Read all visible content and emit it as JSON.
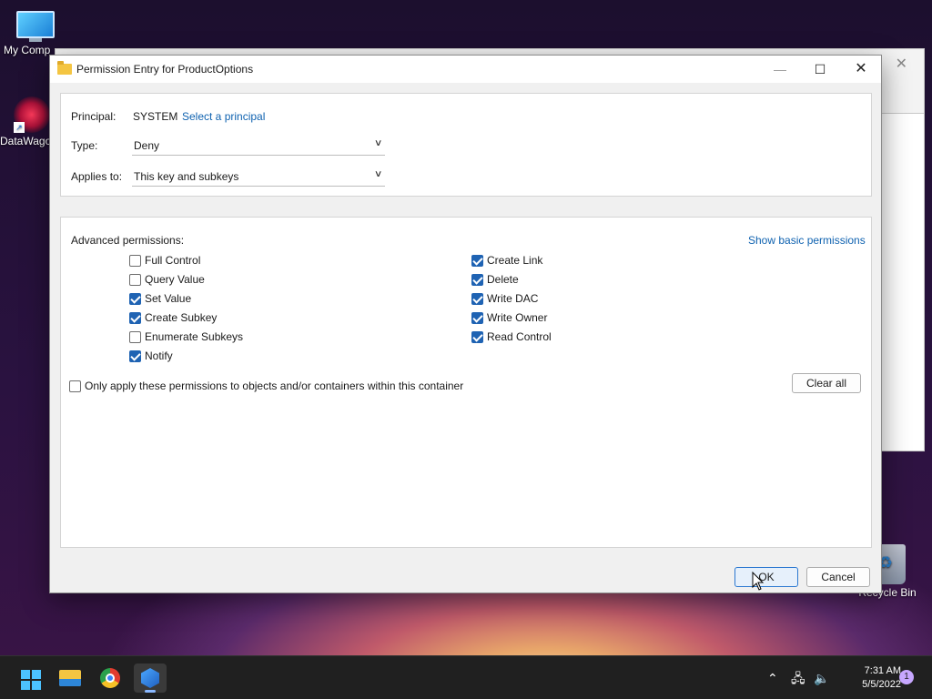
{
  "desktop": {
    "icons": [
      {
        "label": "My Comp"
      },
      {
        "label": "DataWago"
      },
      {
        "label": "Recycle Bin"
      }
    ]
  },
  "dialog": {
    "title": "Permission Entry for ProductOptions",
    "principal_label": "Principal:",
    "principal_value": "SYSTEM",
    "select_principal_link": "Select a principal",
    "type_label": "Type:",
    "type_value": "Deny",
    "applies_label": "Applies to:",
    "applies_value": "This key and subkeys",
    "advanced_label": "Advanced permissions:",
    "show_basic_link": "Show basic permissions",
    "permissions_left": [
      {
        "label": "Full Control",
        "checked": false
      },
      {
        "label": "Query Value",
        "checked": false
      },
      {
        "label": "Set Value",
        "checked": true
      },
      {
        "label": "Create Subkey",
        "checked": true
      },
      {
        "label": "Enumerate Subkeys",
        "checked": false
      },
      {
        "label": "Notify",
        "checked": true
      }
    ],
    "permissions_right": [
      {
        "label": "Create Link",
        "checked": true
      },
      {
        "label": "Delete",
        "checked": true
      },
      {
        "label": "Write DAC",
        "checked": true
      },
      {
        "label": "Write Owner",
        "checked": true
      },
      {
        "label": "Read Control",
        "checked": true
      }
    ],
    "only_apply_label": "Only apply these permissions to objects and/or containers within this container",
    "only_apply_checked": false,
    "clear_all_label": "Clear all",
    "ok_label": "OK",
    "cancel_label": "Cancel"
  },
  "taskbar": {
    "time": "7:31 AM",
    "date": "5/5/2022",
    "notification_count": "1",
    "apps": [
      "start-icon",
      "file-explorer-icon",
      "chrome-icon",
      "datawago-icon"
    ]
  },
  "colors": {
    "accent": "#1f63b3",
    "link": "#0f62b0",
    "taskbar": "#202020"
  }
}
